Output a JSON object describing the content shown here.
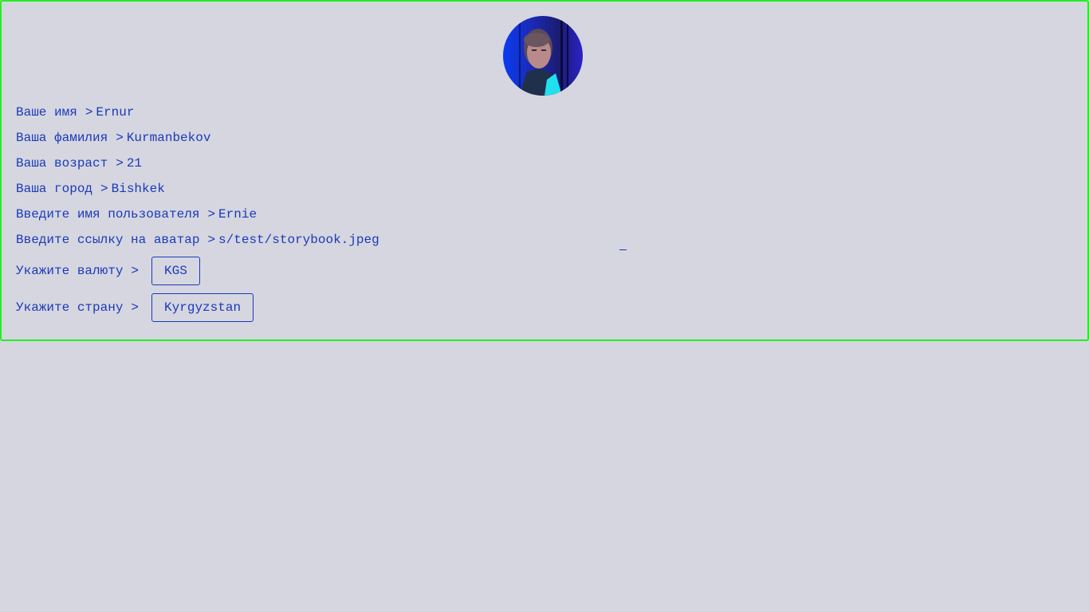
{
  "avatar": {
    "alt": "avatar"
  },
  "fields": [
    {
      "label": "Ваше имя",
      "prompt": ">",
      "value": "Ernur"
    },
    {
      "label": "Ваша фамилия",
      "prompt": ">",
      "value": "Kurmanbekov"
    },
    {
      "label": "Ваша возраст",
      "prompt": ">",
      "value": "21"
    },
    {
      "label": "Ваша город",
      "prompt": ">",
      "value": "Bishkek"
    },
    {
      "label": "Введите имя пользователя",
      "prompt": ">",
      "value": "Ernie"
    },
    {
      "label": "Введите ссылку на аватар",
      "prompt": ">",
      "value": "s/test/storybook.jpeg"
    }
  ],
  "selects": [
    {
      "label": "Укажите валюту",
      "prompt": ">",
      "value": "KGS"
    },
    {
      "label": "Укажите страну",
      "prompt": ">",
      "value": "Kyrgyzstan"
    }
  ],
  "colors": {
    "background": "#d6d6e0",
    "text": "#1a3ab8",
    "panel_border": "#22ee22"
  }
}
